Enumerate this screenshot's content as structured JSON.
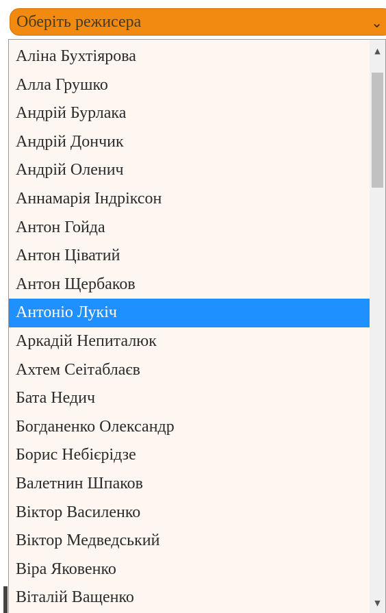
{
  "select": {
    "placeholder": "Оберіть режисера",
    "chevron_icon": "chevron-down-icon"
  },
  "list": {
    "selected_index": 9,
    "items": [
      "Аліна Бухтіярова",
      "Алла Грушко",
      "Андрій Бурлака",
      "Андрій Дончик",
      "Андрій Оленич",
      "Аннамарія Індріксон",
      "Антон Гойда",
      "Антон Ціватий",
      "Антон Щербаков",
      "Антоніо Лукіч",
      "Аркадій Непиталюк",
      "Ахтем Сеітаблаєв",
      "Бата Недич",
      "Богданенко Олександр",
      "Борис Небієрідзе",
      "Валетнин Шпаков",
      "Віктор Василенко",
      "Віктор Медведський",
      "Віра Яковенко",
      "Віталій Ващенко"
    ]
  },
  "colors": {
    "select_bg": "#f28a12",
    "list_bg": "#fdf6f1",
    "highlight": "#1e90ff"
  }
}
